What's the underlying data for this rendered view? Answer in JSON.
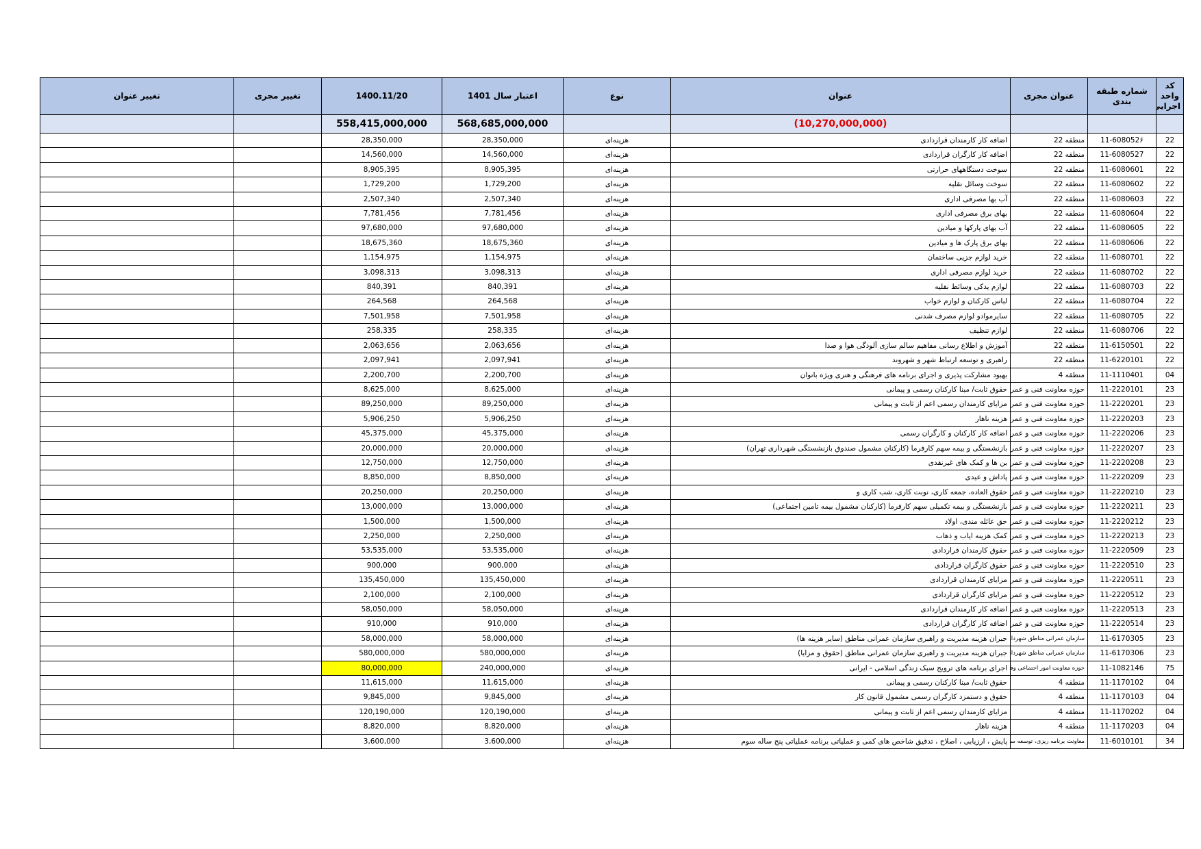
{
  "headers": {
    "unit_code": "کد واحد اجرایی",
    "class_no": "شماره طبقه بندی",
    "agent": "عنوان مجری",
    "title": "عنوان",
    "type": "نوع",
    "credit_1401": "اعتبار سال 1401",
    "date_col": "1400.11/20",
    "change_agent": "تغییر مجری",
    "change_title": "تغییر عنوان"
  },
  "totals": {
    "title_total": "(10,270,000,000)",
    "credit_total": "568,685,000,000",
    "date_total": "558,415,000,000"
  },
  "highlight_color": "#ffff00",
  "rows": [
    {
      "code": "22",
      "cls": "11-608052۶",
      "agent": "منطقه 22",
      "title": "اضافه کار کارمندان قراردادی",
      "type": "هزینه‌ای",
      "credit": "28,350,000",
      "date": "28,350,000"
    },
    {
      "code": "22",
      "cls": "11-6080527",
      "agent": "منطقه 22",
      "title": "اضافه کار کارگران قراردادی",
      "type": "هزینه‌ای",
      "credit": "14,560,000",
      "date": "14,560,000"
    },
    {
      "code": "22",
      "cls": "11-6080601",
      "agent": "منطقه 22",
      "title": "سوخت دستگاههای حرارتی",
      "type": "هزینه‌ای",
      "credit": "8,905,395",
      "date": "8,905,395"
    },
    {
      "code": "22",
      "cls": "11-6080602",
      "agent": "منطقه 22",
      "title": "سوخت وسائل نقلیه",
      "type": "هزینه‌ای",
      "credit": "1,729,200",
      "date": "1,729,200"
    },
    {
      "code": "22",
      "cls": "11-6080603",
      "agent": "منطقه 22",
      "title": "آب بها مصرفی اداری",
      "type": "هزینه‌ای",
      "credit": "2,507,340",
      "date": "2,507,340"
    },
    {
      "code": "22",
      "cls": "11-6080604",
      "agent": "منطقه 22",
      "title": "بهای برق مصرفی اداری",
      "type": "هزینه‌ای",
      "credit": "7,781,456",
      "date": "7,781,456"
    },
    {
      "code": "22",
      "cls": "11-6080605",
      "agent": "منطقه 22",
      "title": "آب بهای پارکها و میادین",
      "type": "هزینه‌ای",
      "credit": "97,680,000",
      "date": "97,680,000"
    },
    {
      "code": "22",
      "cls": "11-6080606",
      "agent": "منطقه 22",
      "title": "بهای برق پارک ها و میادین",
      "type": "هزینه‌ای",
      "credit": "18,675,360",
      "date": "18,675,360"
    },
    {
      "code": "22",
      "cls": "11-6080701",
      "agent": "منطقه 22",
      "title": "خرید لوازم جزیی ساختمان",
      "type": "هزینه‌ای",
      "credit": "1,154,975",
      "date": "1,154,975"
    },
    {
      "code": "22",
      "cls": "11-6080702",
      "agent": "منطقه 22",
      "title": "خرید لوازم مصرفی اداری",
      "type": "هزینه‌ای",
      "credit": "3,098,313",
      "date": "3,098,313"
    },
    {
      "code": "22",
      "cls": "11-6080703",
      "agent": "منطقه 22",
      "title": "لوازم یدکی وسائط نقلیه",
      "type": "هزینه‌ای",
      "credit": "840,391",
      "date": "840,391"
    },
    {
      "code": "22",
      "cls": "11-6080704",
      "agent": "منطقه 22",
      "title": "لباس کارکنان و لوازم خواب",
      "type": "هزینه‌ای",
      "credit": "264,568",
      "date": "264,568"
    },
    {
      "code": "22",
      "cls": "11-6080705",
      "agent": "منطقه 22",
      "title": "سایرموادو لوازم مصرف شدنی",
      "type": "هزینه‌ای",
      "credit": "7,501,958",
      "date": "7,501,958"
    },
    {
      "code": "22",
      "cls": "11-6080706",
      "agent": "منطقه 22",
      "title": "لوازم تنظیف",
      "type": "هزینه‌ای",
      "credit": "258,335",
      "date": "258,335"
    },
    {
      "code": "22",
      "cls": "11-6150501",
      "agent": "منطقه 22",
      "title": "آموزش و اطلاع رسانی مفاهیم سالم سازی آلودگی هوا و صدا",
      "type": "هزینه‌ای",
      "credit": "2,063,656",
      "date": "2,063,656"
    },
    {
      "code": "22",
      "cls": "11-6220101",
      "agent": "منطقه 22",
      "title": "راهبری و توسعه ارتباط شهر و شهروند",
      "type": "هزینه‌ای",
      "credit": "2,097,941",
      "date": "2,097,941"
    },
    {
      "code": "04",
      "cls": "11-1110401",
      "agent": "منطقه 4",
      "title": "بهبود مشارکت پذیری و اجرای برنامه های فرهنگی و هنری ویژه بانوان",
      "type": "هزینه‌ای",
      "credit": "2,200,700",
      "date": "2,200,700"
    },
    {
      "code": "23",
      "cls": "11-2220101",
      "agent": "حوزه معاونت فنی و عمرانی",
      "title": "حقوق ثابت/ مبنا کارکنان رسمی و پیمانی",
      "type": "هزینه‌ای",
      "credit": "8,625,000",
      "date": "8,625,000"
    },
    {
      "code": "23",
      "cls": "11-2220201",
      "agent": "حوزه معاونت فنی و عمرانی",
      "title": "مزایای کارمندان رسمی اعم از ثابت و پیمانی",
      "type": "هزینه‌ای",
      "credit": "89,250,000",
      "date": "89,250,000"
    },
    {
      "code": "23",
      "cls": "11-2220203",
      "agent": "حوزه معاونت فنی و عمرانی",
      "title": "هزینه ناهار",
      "type": "هزینه‌ای",
      "credit": "5,906,250",
      "date": "5,906,250"
    },
    {
      "code": "23",
      "cls": "11-2220206",
      "agent": "حوزه معاونت فنی و عمرانی",
      "title": "اضافه کار کارکنان و کارگران رسمی",
      "type": "هزینه‌ای",
      "credit": "45,375,000",
      "date": "45,375,000"
    },
    {
      "code": "23",
      "cls": "11-2220207",
      "agent": "حوزه معاونت فنی و عمرانی",
      "title": "بازنشستگی و بیمه سهم کارفرما (کارکنان مشمول صندوق بازنشستگی شهرداری تهران)",
      "type": "هزینه‌ای",
      "credit": "20,000,000",
      "date": "20,000,000"
    },
    {
      "code": "23",
      "cls": "11-2220208",
      "agent": "حوزه معاونت فنی و عمرانی",
      "title": "بن ها و کمک های غیرنقدی",
      "type": "هزینه‌ای",
      "credit": "12,750,000",
      "date": "12,750,000"
    },
    {
      "code": "23",
      "cls": "11-2220209",
      "agent": "حوزه معاونت فنی و عمرانی",
      "title": "پاداش و عیدی",
      "type": "هزینه‌ای",
      "credit": "8,850,000",
      "date": "8,850,000"
    },
    {
      "code": "23",
      "cls": "11-2220210",
      "agent": "حوزه معاونت فنی و عمرانی",
      "title": "حقوق العاده، جمعه کاری، نوبت کاری، شب کاری و",
      "type": "هزینه‌ای",
      "credit": "20,250,000",
      "date": "20,250,000"
    },
    {
      "code": "23",
      "cls": "11-2220211",
      "agent": "حوزه معاونت فنی و عمرانی",
      "title": "بازنشستگی و بیمه تکمیلی سهم کارفرما (کارکنان مشمول بیمه تامین اجتماعی)",
      "type": "هزینه‌ای",
      "credit": "13,000,000",
      "date": "13,000,000"
    },
    {
      "code": "23",
      "cls": "11-2220212",
      "agent": "حوزه معاونت فنی و عمرانی",
      "title": "حق عائله مندی، اولاد",
      "type": "هزینه‌ای",
      "credit": "1,500,000",
      "date": "1,500,000"
    },
    {
      "code": "23",
      "cls": "11-2220213",
      "agent": "حوزه معاونت فنی و عمرانی",
      "title": "کمک هزینه ایاب و ذهاب",
      "type": "هزینه‌ای",
      "credit": "2,250,000",
      "date": "2,250,000"
    },
    {
      "code": "23",
      "cls": "11-2220509",
      "agent": "حوزه معاونت فنی و عمرانی",
      "title": "حقوق کارمندان قراردادی",
      "type": "هزینه‌ای",
      "credit": "53,535,000",
      "date": "53,535,000"
    },
    {
      "code": "23",
      "cls": "11-2220510",
      "agent": "حوزه معاونت فنی و عمرانی",
      "title": "حقوق کارگران قراردادی",
      "type": "هزینه‌ای",
      "credit": "900,000",
      "date": "900,000"
    },
    {
      "code": "23",
      "cls": "11-2220511",
      "agent": "حوزه معاونت فنی و عمرانی",
      "title": "مزایای کارمندان قراردادی",
      "type": "هزینه‌ای",
      "credit": "135,450,000",
      "date": "135,450,000"
    },
    {
      "code": "23",
      "cls": "11-2220512",
      "agent": "حوزه معاونت فنی و عمرانی",
      "title": "مزایای کارگران قراردادی",
      "type": "هزینه‌ای",
      "credit": "2,100,000",
      "date": "2,100,000"
    },
    {
      "code": "23",
      "cls": "11-2220513",
      "agent": "حوزه معاونت فنی و عمرانی",
      "title": "اضافه کار کارمندان قراردادی",
      "type": "هزینه‌ای",
      "credit": "58,050,000",
      "date": "58,050,000"
    },
    {
      "code": "23",
      "cls": "11-2220514",
      "agent": "حوزه معاونت فنی و عمرانی",
      "title": "اضافه کار کارگران قراردادی",
      "type": "هزینه‌ای",
      "credit": "910,000",
      "date": "910,000"
    },
    {
      "code": "23",
      "cls": "11-6170305",
      "agent": "سازمان عمرانی مناطق شهرداری تهران",
      "agent_small": true,
      "title": "جبران هزینه مدیریت و راهبری سازمان عمرانی مناطق (سایر هزینه ها)",
      "type": "هزینه‌ای",
      "credit": "58,000,000",
      "date": "58,000,000"
    },
    {
      "code": "23",
      "cls": "11-6170306",
      "agent": "سازمان عمرانی مناطق شهرداری تهران",
      "agent_small": true,
      "title": "جبران هزینه مدیریت و راهبری سازمان عمرانی مناطق (حقوق و مزایا)",
      "type": "هزینه‌ای",
      "credit": "580,000,000",
      "date": "580,000,000"
    },
    {
      "code": "75",
      "cls": "11-1082146",
      "agent": "حوزه معاونت امور اجتماعی وفرهنگی",
      "agent_small": true,
      "title": "اجرای برنامه های ترویج سبک زندگی اسلامی - ایرانی",
      "type": "هزینه‌ای",
      "credit": "240,000,000",
      "date": "80,000,000",
      "highlight": true
    },
    {
      "code": "04",
      "cls": "11-1170102",
      "agent": "منطقه 4",
      "title": "حقوق ثابت/ مبنا کارکنان رسمی و پیمانی",
      "type": "هزینه‌ای",
      "credit": "11,615,000",
      "date": "11,615,000"
    },
    {
      "code": "04",
      "cls": "11-1170103",
      "agent": "منطقه 4",
      "title": "حقوق و دستمزد کارگران رسمی مشمول قانون کار",
      "type": "هزینه‌ای",
      "credit": "9,845,000",
      "date": "9,845,000"
    },
    {
      "code": "04",
      "cls": "11-1170202",
      "agent": "منطقه 4",
      "title": "مزایای کارمندان رسمی اعم از ثابت و پیمانی",
      "type": "هزینه‌ای",
      "credit": "120,190,000",
      "date": "120,190,000"
    },
    {
      "code": "04",
      "cls": "11-1170203",
      "agent": "منطقه 4",
      "title": "هزینه ناهار",
      "type": "هزینه‌ای",
      "credit": "8,820,000",
      "date": "8,820,000"
    },
    {
      "code": "34",
      "cls": "11-6010101",
      "agent": "معاونت برنامه ریزی، توسعه سرمایه انسانی و امور شورا",
      "agent_small": true,
      "title": "پایش ، ارزیابی ، اصلاح ، تدقیق شاخص های کمی و عملیاتی برنامه عملیاتی پنج ساله سوم",
      "type": "هزینه‌ای",
      "credit": "3,600,000",
      "date": "3,600,000"
    }
  ]
}
